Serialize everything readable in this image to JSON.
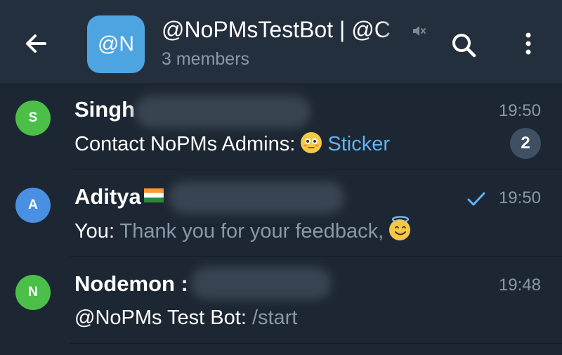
{
  "header": {
    "avatar_text": "@N",
    "title": "@NoPMsTestBot | @C",
    "subtitle": "3 members",
    "colors": {
      "bar": "#242f3d",
      "avatar": "#4ea4e0"
    }
  },
  "chats": [
    {
      "avatar_letter": "S",
      "avatar_color": "#4cbf48",
      "name": "Singh",
      "time": "19:50",
      "preview_prefix": "Contact NoPMs Admins: ",
      "preview_emoji": "flushed-face",
      "preview_accent": "Sticker",
      "unread": "2"
    },
    {
      "avatar_letter": "A",
      "avatar_color": "#4a90e2",
      "name": "Aditya",
      "name_flag": "india-flag",
      "time": "19:50",
      "status": "sent-check",
      "preview_prefix": "You: ",
      "preview_muted": "Thank you for your feedback, ",
      "preview_emoji": "halo-smile"
    },
    {
      "avatar_letter": "N",
      "avatar_color": "#4cbf48",
      "name": "Nodemon :",
      "time": "19:48",
      "preview_prefix": "@NoPMs Test Bot: ",
      "preview_muted": "/start"
    }
  ],
  "icons": [
    "back-arrow-icon",
    "mute-icon",
    "search-icon",
    "more-vert-icon"
  ]
}
